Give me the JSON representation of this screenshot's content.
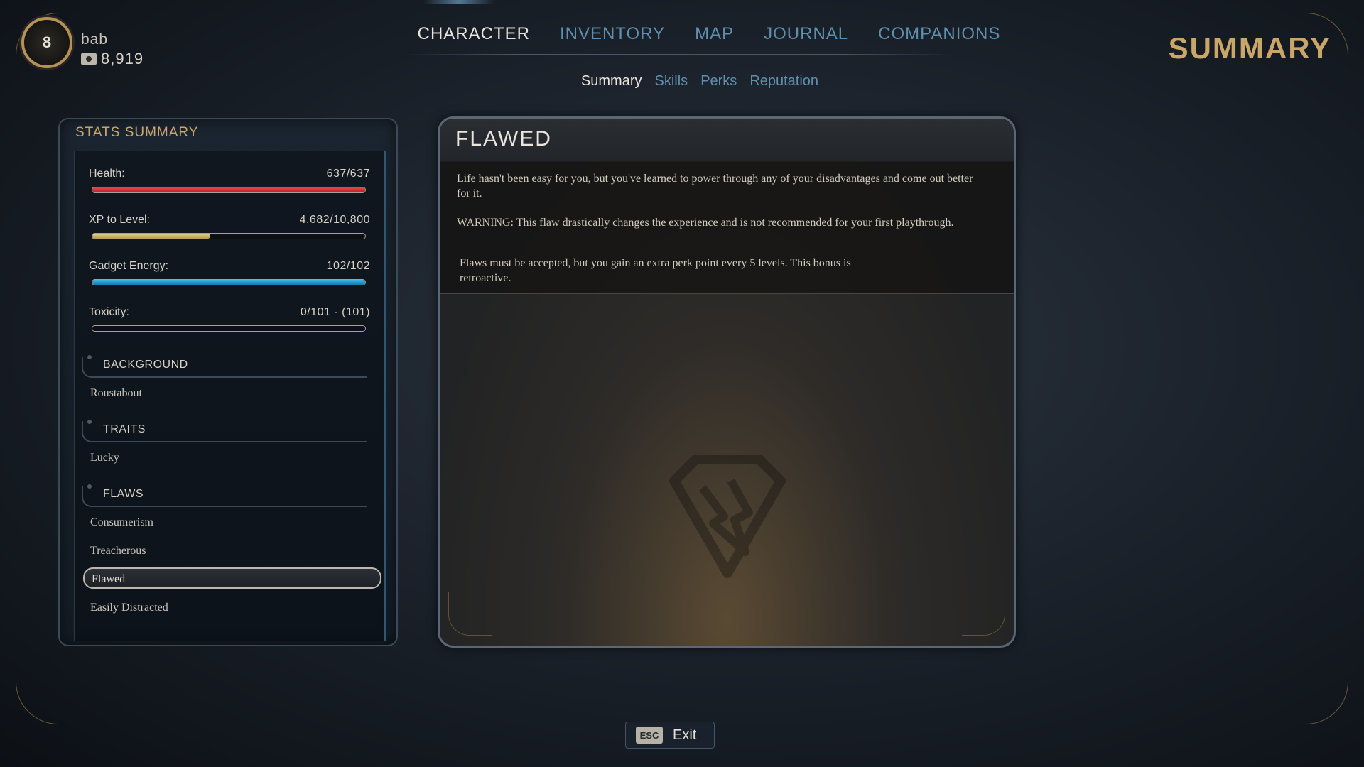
{
  "player": {
    "level": "8",
    "name": "bab",
    "money": "8,919"
  },
  "nav": {
    "tabs": [
      "CHARACTER",
      "INVENTORY",
      "MAP",
      "JOURNAL",
      "COMPANIONS"
    ],
    "active_tab": "CHARACTER",
    "subtabs": [
      "Summary",
      "Skills",
      "Perks",
      "Reputation"
    ],
    "active_subtab": "Summary"
  },
  "page_heading": "SUMMARY",
  "stats": {
    "title": "STATS SUMMARY",
    "health": {
      "label": "Health:",
      "value": "637/637",
      "fraction": 1.0
    },
    "xp": {
      "label": "XP to Level:",
      "value": "4,682/10,800",
      "fraction": 0.4335
    },
    "gadget": {
      "label": "Gadget Energy:",
      "value": "102/102",
      "fraction": 1.0
    },
    "toxicity": {
      "label": "Toxicity:",
      "value": "0/101 - (101)",
      "fraction": 0.0
    }
  },
  "sections": {
    "background": {
      "title": "BACKGROUND",
      "items": [
        "Roustabout"
      ]
    },
    "traits": {
      "title": "TRAITS",
      "items": [
        "Lucky"
      ]
    },
    "flaws": {
      "title": "FLAWS",
      "items": [
        "Consumerism",
        "Treacherous",
        "Flawed",
        "Easily Distracted"
      ],
      "selected": "Flawed"
    }
  },
  "detail": {
    "title": "FLAWED",
    "paragraph1": "Life hasn't been easy for you, but you've learned to power through any of your disadvantages and come out better for it.",
    "paragraph2": "WARNING: This flaw drastically changes the experience and is not recommended for your first playthrough.",
    "paragraph3": "Flaws must be accepted, but you gain an extra perk point every 5 levels. This bonus is retroactive."
  },
  "exit": {
    "key": "ESC",
    "label": "Exit"
  },
  "colors": {
    "accent_gold": "#c9a768",
    "tab_inactive": "#5f8fae",
    "health": "#e23a43",
    "xp": "#d9c47c",
    "gadget": "#2aa3d8"
  }
}
